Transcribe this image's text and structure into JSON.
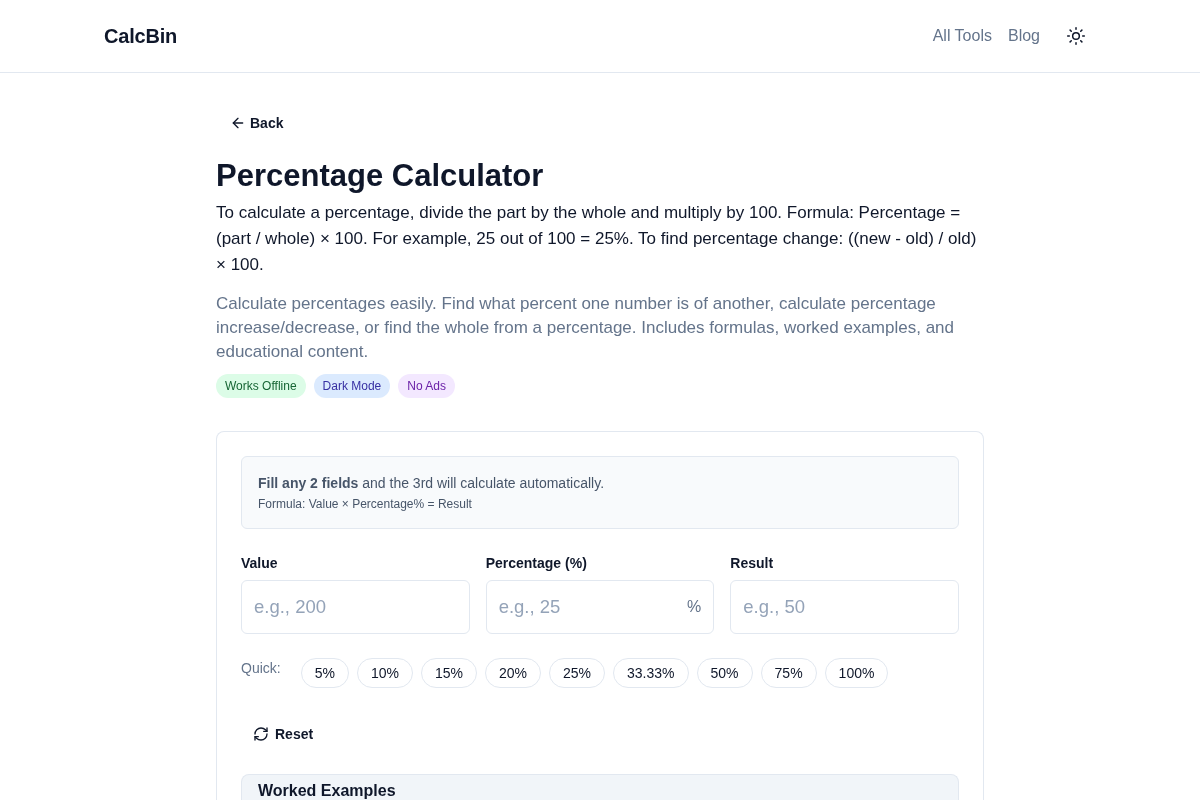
{
  "header": {
    "logo": "CalcBin",
    "nav": [
      {
        "label": "All Tools"
      },
      {
        "label": "Blog"
      }
    ]
  },
  "back": "Back",
  "title": "Percentage Calculator",
  "answer": "To calculate a percentage, divide the part by the whole and multiply by 100. Formula: Percentage = (part / whole) × 100. For example, 25 out of 100 = 25%. To find percentage change: ((new - old) / old) × 100.",
  "description": "Calculate percentages easily. Find what percent one number is of another, calculate percentage increase/decrease, or find the whole from a percentage. Includes formulas, worked examples, and educational content.",
  "badges": [
    {
      "label": "Works Offline",
      "color": "#dcfce7"
    },
    {
      "label": "Dark Mode",
      "color": "#dbeafe"
    },
    {
      "label": "No Ads",
      "color": "#f3e8ff"
    }
  ],
  "calculator": {
    "hint": "**Fill any 2 fields** and the 3rd will calculate automatically.",
    "formula": "Formula: Value × Percentage% = Result",
    "fields": [
      {
        "label": "Value",
        "placeholder": "e.g., 200"
      },
      {
        "label": "Percentage (%)",
        "placeholder": "e.g., 25",
        "suffix": "%"
      },
      {
        "label": "Result",
        "placeholder": "e.g., 50"
      }
    ],
    "quick_label": "Quick:",
    "quick": [
      "5%",
      "10%",
      "15%",
      "20%",
      "25%",
      "33.33%",
      "50%",
      "75%",
      "100%"
    ],
    "reset": "Reset",
    "examples_title": "Worked Examples"
  }
}
